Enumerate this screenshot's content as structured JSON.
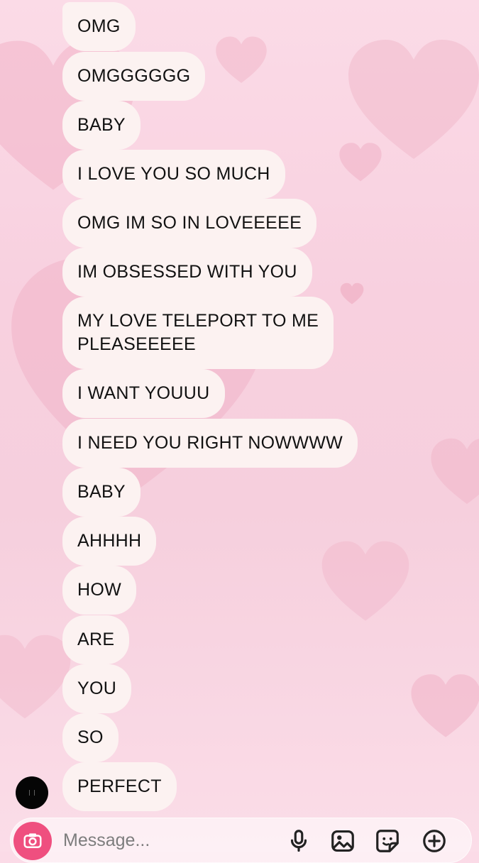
{
  "thread": {
    "messages": [
      {
        "text": "OMG"
      },
      {
        "text": "OMGGGGGG"
      },
      {
        "text": "BABY"
      },
      {
        "text": "I LOVE YOU SO MUCH"
      },
      {
        "text": "OMG IM SO IN LOVEEEEE"
      },
      {
        "text": "IM OBSESSED WITH YOU"
      },
      {
        "text": "MY LOVE TELEPORT TO ME\nPLEASEEEEE"
      },
      {
        "text": "I WANT YOUUU"
      },
      {
        "text": "I NEED YOU RIGHT NOWWWW"
      },
      {
        "text": "BABY"
      },
      {
        "text": "AHHHH"
      },
      {
        "text": "HOW"
      },
      {
        "text": "ARE"
      },
      {
        "text": "YOU"
      },
      {
        "text": "SO"
      },
      {
        "text": "PERFECT"
      }
    ]
  },
  "composer": {
    "placeholder": "Message...",
    "camera_icon": "camera-icon",
    "mic_icon": "microphone-icon",
    "photo_icon": "photo-icon",
    "sticker_icon": "sticker-icon",
    "plus_icon": "plus-icon",
    "accent_color": "#ef4f7f"
  },
  "theme": {
    "bubble_color": "#fcf2f1",
    "background_color": "#f8d0df",
    "heart_color": "#f6b7cb"
  }
}
